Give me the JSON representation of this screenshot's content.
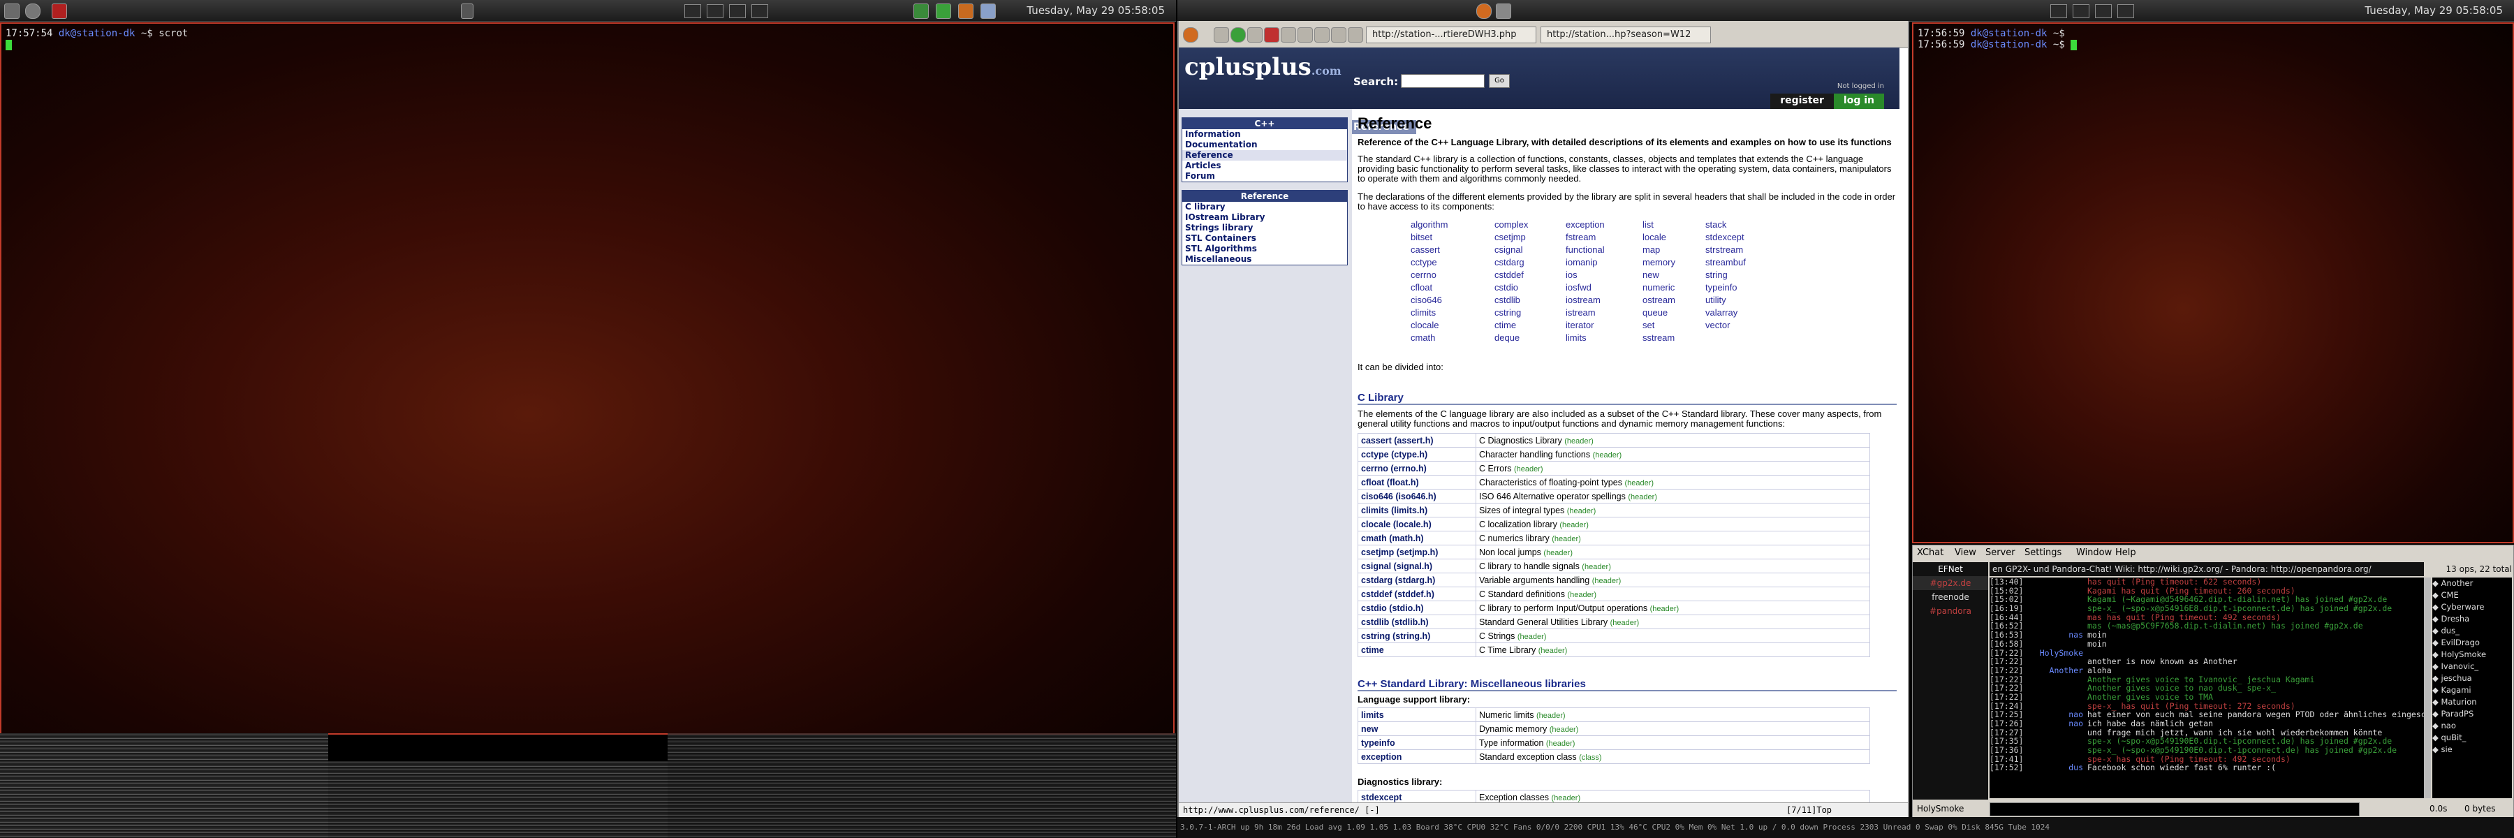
{
  "left_panel": {
    "clock": "Tuesday, May 29 05:58:05",
    "terminal": {
      "time": "17:57:54",
      "user": "dk@station-dk",
      "path": "~$",
      "command": "scrot"
    }
  },
  "right_panel": {
    "clock": "Tuesday, May 29 05:58:05",
    "terminal_lines": [
      {
        "time": "17:56:59",
        "user": "dk@station-dk",
        "path": "~$"
      },
      {
        "time": "17:56:59",
        "user": "dk@station-dk",
        "path": "~$"
      }
    ]
  },
  "browser": {
    "tabs": [
      "http://station-...rtiereDWH3.php",
      "http://station...hp?season=W12"
    ],
    "site": {
      "logo_main": "cplusplus",
      "logo_sub": ".com",
      "search_label": "Search:",
      "go_label": "Go",
      "not_logged_in": "Not logged in",
      "register": "register",
      "login": "log in",
      "ref_tab": "Reference"
    },
    "sidebar": {
      "cpp_title": "C++",
      "cpp_items": [
        "Information",
        "Documentation",
        "Reference",
        "Articles",
        "Forum"
      ],
      "ref_title": "Reference",
      "ref_items": [
        "C library",
        "IOstream Library",
        "Strings library",
        "STL Containers",
        "STL Algorithms",
        "Miscellaneous"
      ]
    },
    "main": {
      "title": "Reference",
      "lead": "Reference of the C++ Language Library, with detailed descriptions of its elements and examples on how to use its functions",
      "para1": "The standard C++ library is a collection of functions, constants, classes, objects and templates that extends the C++ language providing basic functionality to perform several tasks, like classes to interact with the operating system, data containers, manipulators to operate with them and algorithms commonly needed.",
      "para2": "The declarations of the different elements provided by the library are split in several headers that shall be included in the code in order to have access to its components:",
      "header_cols": [
        [
          "algorithm",
          "bitset",
          "cassert",
          "cctype",
          "cerrno",
          "cfloat",
          "ciso646",
          "climits",
          "clocale",
          "cmath"
        ],
        [
          "complex",
          "csetjmp",
          "csignal",
          "cstdarg",
          "cstddef",
          "cstdio",
          "cstdlib",
          "cstring",
          "ctime",
          "deque"
        ],
        [
          "exception",
          "fstream",
          "functional",
          "iomanip",
          "ios",
          "iosfwd",
          "iostream",
          "istream",
          "iterator",
          "limits"
        ],
        [
          "list",
          "locale",
          "map",
          "memory",
          "new",
          "numeric",
          "ostream",
          "queue",
          "set",
          "sstream"
        ],
        [
          "stack",
          "stdexcept",
          "strstream",
          "streambuf",
          "string",
          "typeinfo",
          "utility",
          "valarray",
          "vector"
        ]
      ],
      "divided": "It can be divided into:",
      "c_lib_title": "C Library",
      "c_lib_para": "The elements of the C language library are also included as a subset of the C++ Standard library. These cover many aspects, from general utility functions and macros to input/output functions and dynamic memory management functions:",
      "header_tag": "(header)",
      "c_lib_rows": [
        [
          "cassert (assert.h)",
          "C Diagnostics Library"
        ],
        [
          "cctype (ctype.h)",
          "Character handling functions"
        ],
        [
          "cerrno (errno.h)",
          "C Errors"
        ],
        [
          "cfloat (float.h)",
          "Characteristics of floating-point types"
        ],
        [
          "ciso646 (iso646.h)",
          "ISO 646 Alternative operator spellings"
        ],
        [
          "climits (limits.h)",
          "Sizes of integral types"
        ],
        [
          "clocale (locale.h)",
          "C localization library"
        ],
        [
          "cmath (math.h)",
          "C numerics library"
        ],
        [
          "csetjmp (setjmp.h)",
          "Non local jumps"
        ],
        [
          "csignal (signal.h)",
          "C library to handle signals"
        ],
        [
          "cstdarg (stdarg.h)",
          "Variable arguments handling"
        ],
        [
          "cstddef (stddef.h)",
          "C Standard definitions"
        ],
        [
          "cstdio (stdio.h)",
          "C library to perform Input/Output operations"
        ],
        [
          "cstdlib (stdlib.h)",
          "Standard General Utilities Library"
        ],
        [
          "cstring (string.h)",
          "C Strings"
        ],
        [
          "ctime",
          "C Time Library"
        ]
      ],
      "misc_title": "C++ Standard Library: Miscellaneous libraries",
      "lang_support": "Language support library:",
      "lang_rows": [
        [
          "limits",
          "Numeric limits",
          "(header)"
        ],
        [
          "new",
          "Dynamic memory",
          "(header)"
        ],
        [
          "typeinfo",
          "Type information",
          "(header)"
        ],
        [
          "exception",
          "Standard exception class",
          "(class)"
        ]
      ],
      "diag": "Diagnostics library:",
      "diag_rows": [
        [
          "stdexcept",
          "Exception classes",
          "(header)"
        ]
      ]
    },
    "status_url": "http://www.cplusplus.com/reference/ [-]",
    "status_pos": "[7/11]Top"
  },
  "bottom_status": "3.0.7-1-ARCH  up 9h 18m 26d  Load avg 1.09 1.05 1.03   Board 38°C  CPU0 32°C  Fans 0/0/0 2200   CPU1 13% 46°C  CPU2 0%  Mem 0%  Net  1.0 up / 0.0 down   Process 2303  Unread 0   Swap 0%  Disk 845G  Tube 1024",
  "xchat": {
    "menu": [
      "XChat",
      "View",
      "Server",
      "Settings",
      "Window",
      "Help"
    ],
    "servers": [
      "EFNet",
      "#gp2x.de",
      "freenode",
      "#pandora"
    ],
    "topic": "en GP2X- und Pandora-Chat! Wiki: http://wiki.gp2x.org/ - Pandora: http://openpandora.org/",
    "ops": "13 ops, 22 total",
    "log": [
      [
        "[13:40]",
        "",
        "has quit (Ping timeout: 622 seconds)",
        "#c04040"
      ],
      [
        "[15:02]",
        "",
        "Kagami has quit (Ping timeout: 260 seconds)",
        "#c04040"
      ],
      [
        "[15:02]",
        "",
        "Kagami (~Kagami@d5496462.dip.t-dialin.net) has joined #gp2x.de",
        "#3aa03a"
      ],
      [
        "[16:19]",
        "",
        "spe-x_ (~spo-x@p54916E8.dip.t-ipconnect.de) has joined #gp2x.de",
        "#3aa03a"
      ],
      [
        "[16:44]",
        "",
        "mas has quit (Ping timeout: 492 seconds)",
        "#c04040"
      ],
      [
        "[16:52]",
        "",
        "mas (~mas@p5C9F7658.dip.t-dialin.net) has joined #gp2x.de",
        "#3aa03a"
      ],
      [
        "[16:53]",
        "nas",
        "moin",
        "#dddddd"
      ],
      [
        "[16:58]",
        "",
        "moin",
        "#dddddd"
      ],
      [
        "[17:22]",
        "HolySmoke",
        "",
        "#dddddd"
      ],
      [
        "[17:22]",
        "",
        "another is now known as Another",
        "#dddddd"
      ],
      [
        "[17:22]",
        "Another",
        "aloha",
        "#dddddd"
      ],
      [
        "[17:22]",
        "",
        "Another gives voice to Ivanovic_ jeschua Kagami",
        "#3aa03a"
      ],
      [
        "[17:22]",
        "",
        "Another gives voice to nao dusk_ spe-x_",
        "#3aa03a"
      ],
      [
        "[17:22]",
        "",
        "Another gives voice to TMA",
        "#3aa03a"
      ],
      [
        "[17:24]",
        "",
        "spe-x_ has quit (Ping timeout: 272 seconds)",
        "#c04040"
      ],
      [
        "[17:25]",
        "nao",
        "hat einer von euch mal seine pandora wegen PTOD oder ähnliches eingeschickt?",
        "#dddddd"
      ],
      [
        "[17:26]",
        "nao",
        "ich habe das nämlich getan",
        "#dddddd"
      ],
      [
        "[17:27]",
        "",
        "und frage mich jetzt, wann ich sie wohl wiederbekommen könnte",
        "#dddddd"
      ],
      [
        "[17:35]",
        "",
        "spe-x (~spo-x@p549190E0.dip.t-ipconnect.de) has joined #gp2x.de",
        "#3aa03a"
      ],
      [
        "[17:36]",
        "",
        "spe-x_ (~spo-x@p549190E0.dip.t-ipconnect.de) has joined #gp2x.de",
        "#3aa03a"
      ],
      [
        "[17:41]",
        "",
        "spe-x has quit (Ping timeout: 492 seconds)",
        "#c04040"
      ],
      [
        "[17:52]",
        "dus",
        "Facebook schon wieder fast 6% runter :(",
        "#dddddd"
      ]
    ],
    "users": [
      "Another",
      "CME",
      "Cyberware",
      "Dresha",
      "dus_",
      "EvilDrago",
      "HolySmoke",
      "Ivanovic_",
      "jeschua",
      "Kagami",
      "Maturion",
      "ParadPS",
      "nao",
      "quBit_",
      "sie"
    ],
    "nick": "HolySmoke",
    "lag": "0.0s",
    "bytes": "0 bytes"
  }
}
